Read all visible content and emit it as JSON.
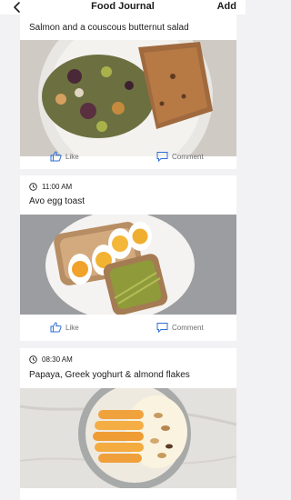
{
  "header": {
    "title": "Food Journal",
    "add_label": "Add",
    "back_icon": "chevron-left-icon"
  },
  "entries": [
    {
      "time": "",
      "caption": "Salmon and a couscous butternut salad",
      "photo_icon": "salmon-salad-photo"
    },
    {
      "time": "11:00 AM",
      "caption": "Avo egg toast",
      "photo_icon": "avo-egg-toast-photo"
    },
    {
      "time": "08:30 AM",
      "caption": "Papaya, Greek yoghurt & almond flakes",
      "photo_icon": "papaya-yoghurt-photo"
    }
  ],
  "actions": {
    "like_label": "Like",
    "comment_label": "Comment"
  },
  "colors": {
    "accent": "#2f6fd6",
    "card_background": "#ffffff",
    "page_background": "#f2f2f4"
  }
}
